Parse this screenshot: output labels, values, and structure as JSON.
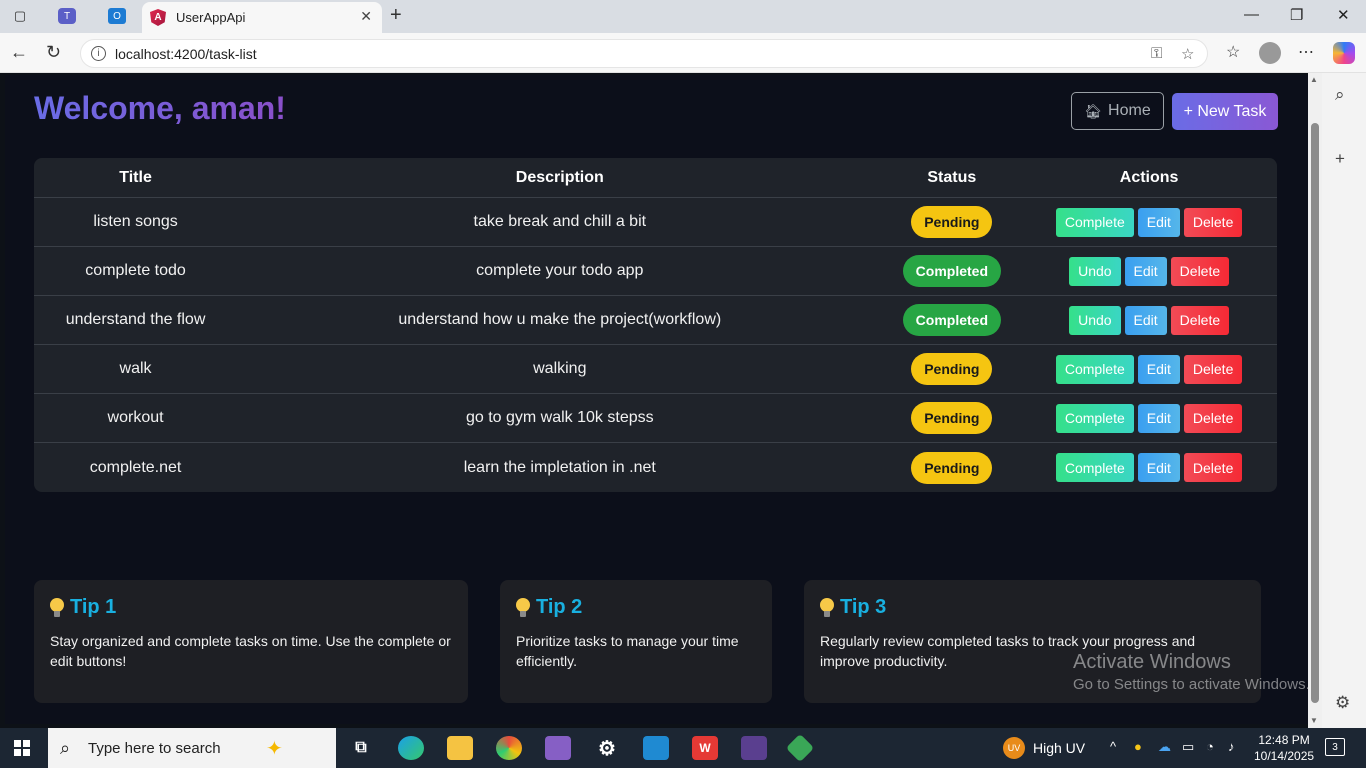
{
  "browser": {
    "tab_title": "UserAppApi",
    "url": "localhost:4200/task-list"
  },
  "page": {
    "welcome": "Welcome, aman!",
    "home_label": "Home",
    "new_task_label": "+ New Task"
  },
  "table": {
    "headers": [
      "Title",
      "Description",
      "Status",
      "Actions"
    ],
    "rows": [
      {
        "title": "listen songs",
        "description": "take break and chill a bit",
        "status": "Pending",
        "primary": "Complete",
        "edit": "Edit",
        "delete": "Delete"
      },
      {
        "title": "complete todo",
        "description": "complete your todo app",
        "status": "Completed",
        "primary": "Undo",
        "edit": "Edit",
        "delete": "Delete"
      },
      {
        "title": "understand the flow",
        "description": "understand how u make the project(workflow)",
        "status": "Completed",
        "primary": "Undo",
        "edit": "Edit",
        "delete": "Delete"
      },
      {
        "title": "walk",
        "description": "walking",
        "status": "Pending",
        "primary": "Complete",
        "edit": "Edit",
        "delete": "Delete"
      },
      {
        "title": "workout",
        "description": "go to gym walk 10k stepss",
        "status": "Pending",
        "primary": "Complete",
        "edit": "Edit",
        "delete": "Delete"
      },
      {
        "title": "complete.net",
        "description": "learn the impletation in .net",
        "status": "Pending",
        "primary": "Complete",
        "edit": "Edit",
        "delete": "Delete"
      }
    ]
  },
  "tips": [
    {
      "title": "Tip 1",
      "text": "Stay organized and complete tasks on time. Use the complete or edit buttons!"
    },
    {
      "title": "Tip 2",
      "text": "Prioritize tasks to manage your time efficiently."
    },
    {
      "title": "Tip 3",
      "text": "Regularly review completed tasks to track your progress and improve productivity."
    }
  ],
  "watermark": {
    "line1": "Activate Windows",
    "line2": "Go to Settings to activate Windows."
  },
  "taskbar": {
    "search_placeholder": "Type here to search",
    "weather_badge": "UV",
    "weather": "High UV",
    "time": "12:48 PM",
    "date": "10/14/2025",
    "notifications": "3"
  },
  "colors": {
    "pending": "#f5c511",
    "completed": "#27a644",
    "complete_btn": "#35e08a",
    "edit_btn": "#3a9ff0",
    "delete_btn": "#f24b56",
    "accent": "#6a6ce6",
    "tip_heading": "#19b0e0"
  }
}
